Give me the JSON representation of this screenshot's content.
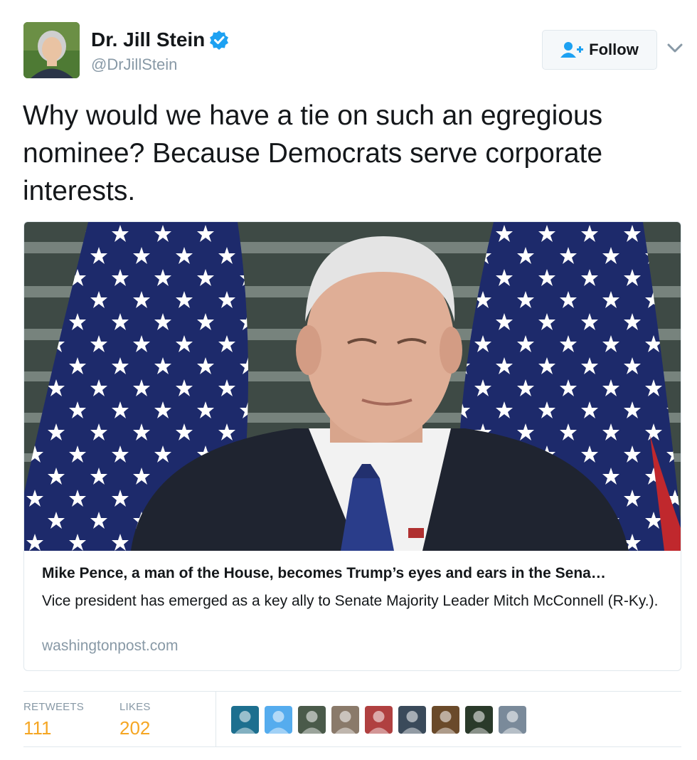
{
  "author": {
    "name": "Dr. Jill Stein",
    "handle": "@DrJillStein",
    "verified_icon": "verified-badge-icon"
  },
  "follow_button": {
    "label": "Follow",
    "icon": "add-user-icon"
  },
  "more_menu_icon": "chevron-down-icon",
  "tweet": {
    "text": "Why would we have a tie on such an egregious nominee? Because Democrats serve corporate interests."
  },
  "card": {
    "image_icon": "article-photo",
    "title": "Mike Pence, a man of the House, becomes Trump’s eyes and ears in the Sena…",
    "description": "Vice president has emerged as a key ally to Senate Majority Leader Mitch McConnell (R-Ky.).",
    "domain": "washingtonpost.com"
  },
  "stats": {
    "retweets_label": "RETWEETS",
    "retweets_value": "111",
    "likes_label": "LIKES",
    "likes_value": "202"
  },
  "liker_avatars": [
    {
      "name": "liker-avatar-1",
      "color": "#1d6f8f"
    },
    {
      "name": "liker-avatar-2",
      "color": "#55acee"
    },
    {
      "name": "liker-avatar-3",
      "color": "#4a5a4a"
    },
    {
      "name": "liker-avatar-4",
      "color": "#8a7a6a"
    },
    {
      "name": "liker-avatar-5",
      "color": "#b04040"
    },
    {
      "name": "liker-avatar-6",
      "color": "#3a4a5a"
    },
    {
      "name": "liker-avatar-7",
      "color": "#6a4a2a"
    },
    {
      "name": "liker-avatar-8",
      "color": "#2a3a2a"
    },
    {
      "name": "liker-avatar-9",
      "color": "#7a8a9a"
    }
  ],
  "colors": {
    "verified": "#1da1f2",
    "stat_value": "#f5a623",
    "muted": "#8899a6"
  }
}
